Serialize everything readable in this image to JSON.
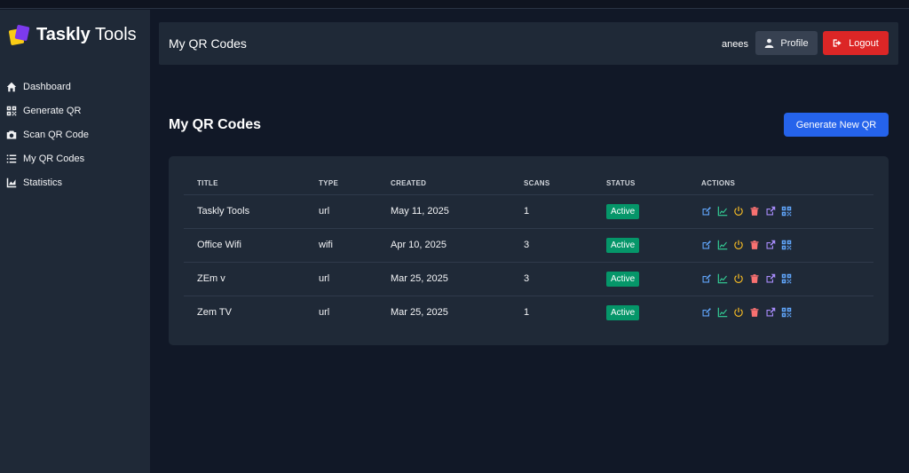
{
  "app": {
    "brand_bold": "Taskly",
    "brand_light": "Tools"
  },
  "sidebar": {
    "items": [
      {
        "label": "Dashboard",
        "icon": "home-icon"
      },
      {
        "label": "Generate QR",
        "icon": "qrcode-icon"
      },
      {
        "label": "Scan QR Code",
        "icon": "camera-icon"
      },
      {
        "label": "My QR Codes",
        "icon": "list-icon"
      },
      {
        "label": "Statistics",
        "icon": "chart-area-icon"
      }
    ]
  },
  "header": {
    "title": "My QR Codes",
    "username": "anees",
    "profile_label": "Profile",
    "logout_label": "Logout"
  },
  "main": {
    "title": "My QR Codes",
    "generate_label": "Generate New QR"
  },
  "table": {
    "columns": [
      "TITLE",
      "TYPE",
      "CREATED",
      "SCANS",
      "STATUS",
      "ACTIONS"
    ],
    "rows": [
      {
        "title": "Taskly Tools",
        "type": "url",
        "created": "May 11, 2025",
        "scans": "1",
        "status": "Active"
      },
      {
        "title": "Office Wifi",
        "type": "wifi",
        "created": "Apr 10, 2025",
        "scans": "3",
        "status": "Active"
      },
      {
        "title": "ZEm v",
        "type": "url",
        "created": "Mar 25, 2025",
        "scans": "3",
        "status": "Active"
      },
      {
        "title": "Zem TV",
        "type": "url",
        "created": "Mar 25, 2025",
        "scans": "1",
        "status": "Active"
      }
    ],
    "action_icons": [
      {
        "name": "edit-icon",
        "color": "#60a5fa"
      },
      {
        "name": "stats-icon",
        "color": "#34d399"
      },
      {
        "name": "power-icon",
        "color": "#fbbf24"
      },
      {
        "name": "trash-icon",
        "color": "#f87171"
      },
      {
        "name": "external-link-icon",
        "color": "#a78bfa"
      },
      {
        "name": "qrcode-icon",
        "color": "#60a5fa"
      }
    ]
  },
  "colors": {
    "background": "#111827",
    "panel": "#1f2937",
    "primary": "#2563eb",
    "danger": "#dc2626",
    "success": "#059669"
  }
}
